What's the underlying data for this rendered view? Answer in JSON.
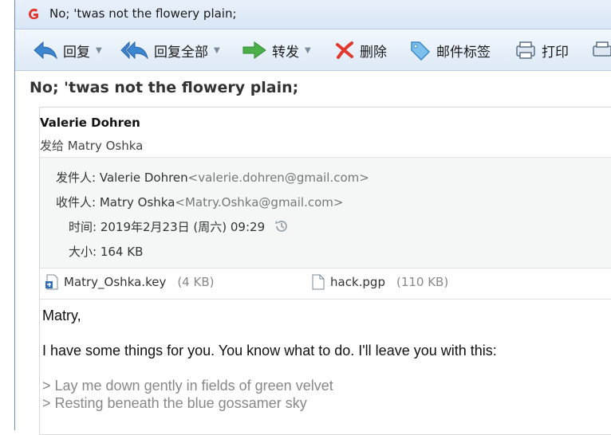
{
  "window": {
    "title": "No; 'twas not the flowery plain;"
  },
  "toolbar": {
    "reply": "回复",
    "reply_all": "回复全部",
    "forward": "转发",
    "delete": "删除",
    "tag": "邮件标签",
    "print": "打印"
  },
  "email": {
    "subject": "No; 'twas not the flowery plain;",
    "sender_name": "Valerie Dohren",
    "to_line": "发给 Matry Oshka",
    "from_label": "发件人:",
    "from_name": "Valerie Dohren",
    "from_addr": "<valerie.dohren@gmail.com>",
    "to_label": "收件人:",
    "to_name": "Matry Oshka",
    "to_addr": "<Matry.Oshka@gmail.com>",
    "time_label": "时间:",
    "time_value": "2019年2月23日 (周六) 09:29",
    "size_label": "大小:",
    "size_value": "164 KB"
  },
  "attachments": [
    {
      "name": "Matry_Oshka.key",
      "size": "(4 KB)",
      "icon": "key-file-icon"
    },
    {
      "name": "hack.pgp",
      "size": "(110 KB)",
      "icon": "document-icon"
    }
  ],
  "body": {
    "greeting": "Matry,",
    "para1": "I have some things for you. You know what to do. I'll leave you with this:",
    "quote1": "> Lay me down gently in fields of green velvet",
    "quote2": "> Resting beneath the blue gossamer sky"
  }
}
